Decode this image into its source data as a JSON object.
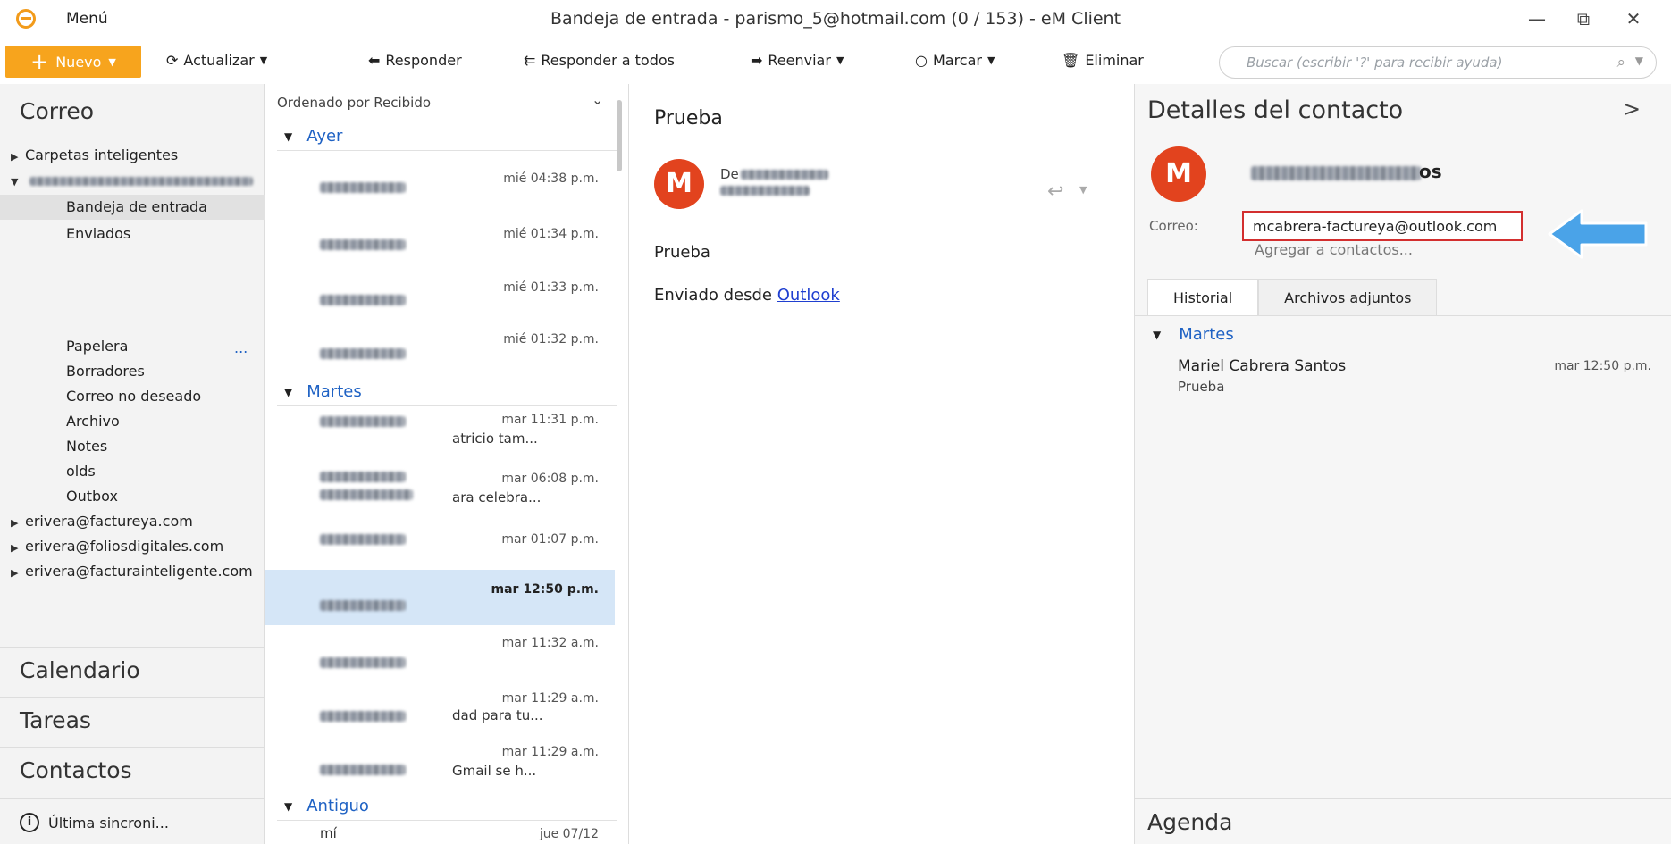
{
  "app": {
    "menu_label": "Menú",
    "window_title": "Bandeja de entrada - parismo_5@hotmail.com (0 / 153) - eM Client",
    "minimize": "—",
    "restore": "⧉",
    "close": "✕"
  },
  "toolbar": {
    "new_label": "Nuevo",
    "refresh_label": "Actualizar",
    "reply_label": "Responder",
    "reply_all_label": "Responder a todos",
    "forward_label": "Reenviar",
    "mark_label": "Marcar",
    "delete_label": "Eliminar",
    "search_placeholder": "Buscar (escribir '?' para recibir ayuda)"
  },
  "nav": {
    "mail_heading": "Correo",
    "smart_folders": "Carpetas inteligentes",
    "account_blurred": "pAriasho_5@hotmail.com",
    "folders": [
      "Bandeja de entrada",
      "Enviados",
      "Papelera",
      "Borradores",
      "Correo no deseado",
      "Archivo",
      "Notes",
      "olds",
      "Outbox"
    ],
    "more": "...",
    "accounts": [
      "erivera@factureya.com",
      "erivera@foliosdigitales.com",
      "erivera@facturainteligente.com"
    ],
    "calendar": "Calendario",
    "tasks": "Tareas",
    "contacts": "Contactos",
    "sync_status": "Última sincroni..."
  },
  "list": {
    "sort_label": "Ordenado por Recibido",
    "groups": [
      "Ayer",
      "Martes",
      "Antiguo"
    ],
    "messages": [
      {
        "time": "mié 04:38 p.m.",
        "snippet": ""
      },
      {
        "time": "mié 01:34 p.m.",
        "snippet": ""
      },
      {
        "time": "mié 01:33 p.m.",
        "snippet": ""
      },
      {
        "time": "mié 01:32 p.m.",
        "snippet": ""
      },
      {
        "time": "mar 11:31 p.m.",
        "snippet": "atricio tam..."
      },
      {
        "time": "mar 06:08 p.m.",
        "snippet": "ara celebra..."
      },
      {
        "time": "mar 01:07 p.m.",
        "snippet": ""
      },
      {
        "time": "mar 12:50 p.m.",
        "snippet": ""
      },
      {
        "time": "mar 11:32 a.m.",
        "snippet": ""
      },
      {
        "time": "mar 11:29 a.m.",
        "snippet": "dad para tu..."
      },
      {
        "time": "mar 11:29 a.m.",
        "snippet": "Gmail se h..."
      },
      {
        "time": "jue 07/12",
        "snippet": "mí"
      }
    ]
  },
  "reader": {
    "subject": "Prueba",
    "avatar_letter": "M",
    "from_label": "De",
    "body_line1": "Prueba",
    "body_line2_prefix": "Enviado desde",
    "body_link": "Outlook"
  },
  "contact": {
    "heading": "Detalles del contacto",
    "avatar_letter": "M",
    "name_tail": "os",
    "mail_label": "Correo:",
    "email": "mcabrera-factureya@outlook.com",
    "add_to_contacts": "Agregar a contactos...",
    "tab_history": "Historial",
    "tab_attachments": "Archivos adjuntos",
    "group": "Martes",
    "history_name": "Mariel Cabrera Santos",
    "history_time": "mar 12:50 p.m.",
    "history_subject": "Prueba",
    "agenda": "Agenda"
  },
  "colors": {
    "accent_orange": "#f7a41d",
    "link_blue": "#1f62c4",
    "avatar_red": "#e2431e",
    "highlight_red": "#d32f2f",
    "arrow_blue": "#4aa3e8",
    "selected_row": "#d5e6f7"
  }
}
